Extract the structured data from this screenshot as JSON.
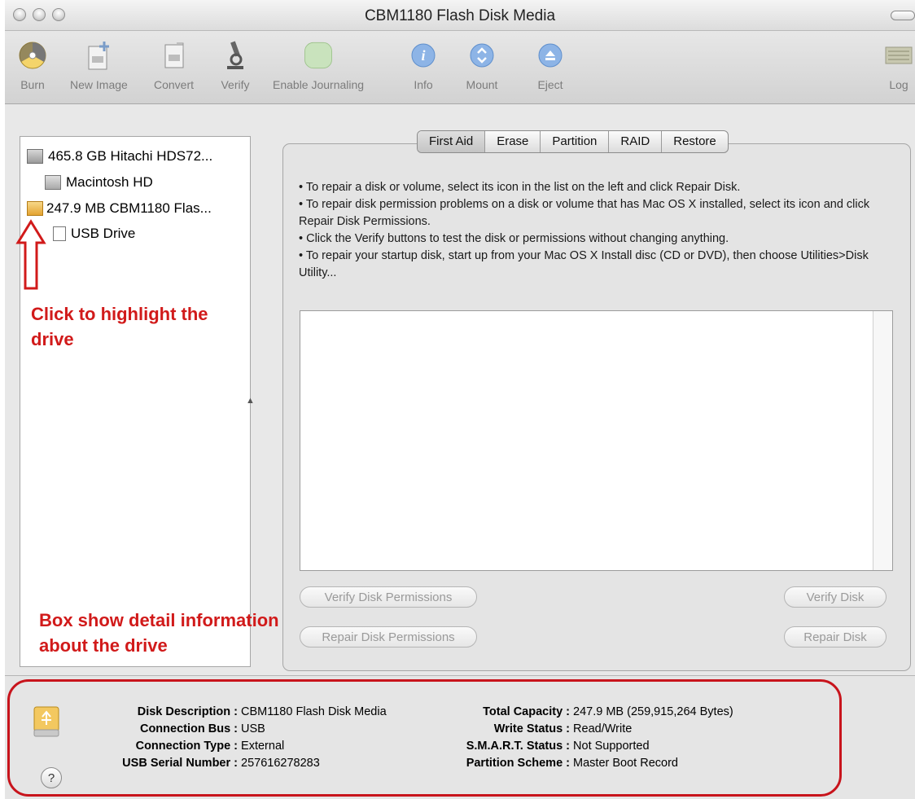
{
  "window": {
    "title": "CBM1180 Flash Disk Media"
  },
  "toolbar": {
    "items": [
      {
        "label": "Burn",
        "icon": "burn-icon"
      },
      {
        "label": "New Image",
        "icon": "new-image-icon"
      },
      {
        "label": "Convert",
        "icon": "convert-icon"
      },
      {
        "label": "Verify",
        "icon": "microscope-icon"
      },
      {
        "label": "Enable Journaling",
        "icon": "journaling-icon"
      },
      {
        "label": "Info",
        "icon": "info-icon"
      },
      {
        "label": "Mount",
        "icon": "mount-icon"
      },
      {
        "label": "Eject",
        "icon": "eject-icon"
      },
      {
        "label": "Log",
        "icon": "log-icon"
      }
    ]
  },
  "sidebar": {
    "items": [
      {
        "label": "465.8 GB Hitachi HDS72...",
        "icon": "hard-disk-icon"
      },
      {
        "label": "Macintosh HD",
        "icon": "volume-icon"
      },
      {
        "label": "247.9 MB CBM1180 Flas...",
        "icon": "usb-disk-icon"
      },
      {
        "label": "USB Drive",
        "icon": "volume-checkbox-icon"
      }
    ]
  },
  "tabs": {
    "items": [
      "First Aid",
      "Erase",
      "Partition",
      "RAID",
      "Restore"
    ],
    "active": "First Aid"
  },
  "first_aid": {
    "instructions": [
      "• To repair a disk or volume, select its icon in the list on the left and click Repair Disk.",
      "• To repair disk permission problems on a disk or volume that has Mac OS X installed, select its icon and click Repair Disk Permissions.",
      "• Click the Verify buttons to test the disk or permissions without changing anything.",
      "• To repair your startup disk, start up from your Mac OS X Install disc (CD or DVD), then choose Utilities>Disk Utility..."
    ],
    "buttons": {
      "verify_permissions": "Verify Disk Permissions",
      "repair_permissions": "Repair Disk Permissions",
      "verify_disk": "Verify Disk",
      "repair_disk": "Repair Disk"
    }
  },
  "info": {
    "disk_description_label": "Disk Description :",
    "disk_description": "CBM1180 Flash Disk Media",
    "connection_bus_label": "Connection Bus :",
    "connection_bus": "USB",
    "connection_type_label": "Connection Type :",
    "connection_type": "External",
    "usb_serial_label": "USB Serial Number :",
    "usb_serial": "257616278283",
    "total_capacity_label": "Total Capacity :",
    "total_capacity": "247.9 MB (259,915,264 Bytes)",
    "write_status_label": "Write Status :",
    "write_status": "Read/Write",
    "smart_status_label": "S.M.A.R.T. Status :",
    "smart_status": "Not Supported",
    "partition_scheme_label": "Partition Scheme :",
    "partition_scheme": "Master Boot Record",
    "help_label": "?"
  },
  "annotations": {
    "click_highlight": [
      "Click to highlight the",
      "drive"
    ],
    "box_detail": [
      "Box show detail information",
      "about the drive"
    ],
    "color": "#d11a1a"
  }
}
